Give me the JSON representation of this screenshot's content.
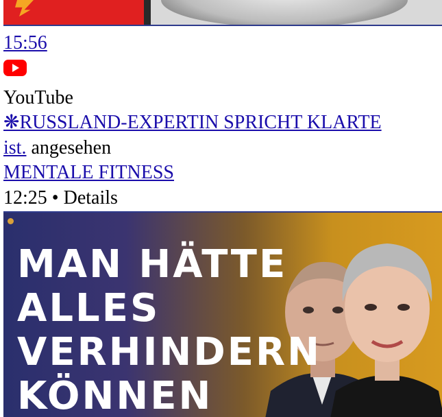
{
  "previous_result": {
    "thumbnail_icon": "lightning-bolt-icon"
  },
  "video": {
    "duration": "15:56",
    "source_icon": "youtube-logo-icon",
    "source": "YouTube",
    "title": "❋RUSSLAND-EXPERTIN SPRICHT KLARTE",
    "watched_link": "ist.",
    "watched_suffix": " angesehen",
    "channel": "MENTALE FITNESS",
    "timestamp": "12:25",
    "separator": " • ",
    "details_label": "Details",
    "thumbnail_lines": [
      "MAN HÄTTE",
      "ALLES",
      "VERHINDERN",
      "KÖNNEN"
    ]
  },
  "colors": {
    "link": "#1a0dab",
    "youtube_red": "#ff0000",
    "thumb_accent": "#d79a1f"
  }
}
